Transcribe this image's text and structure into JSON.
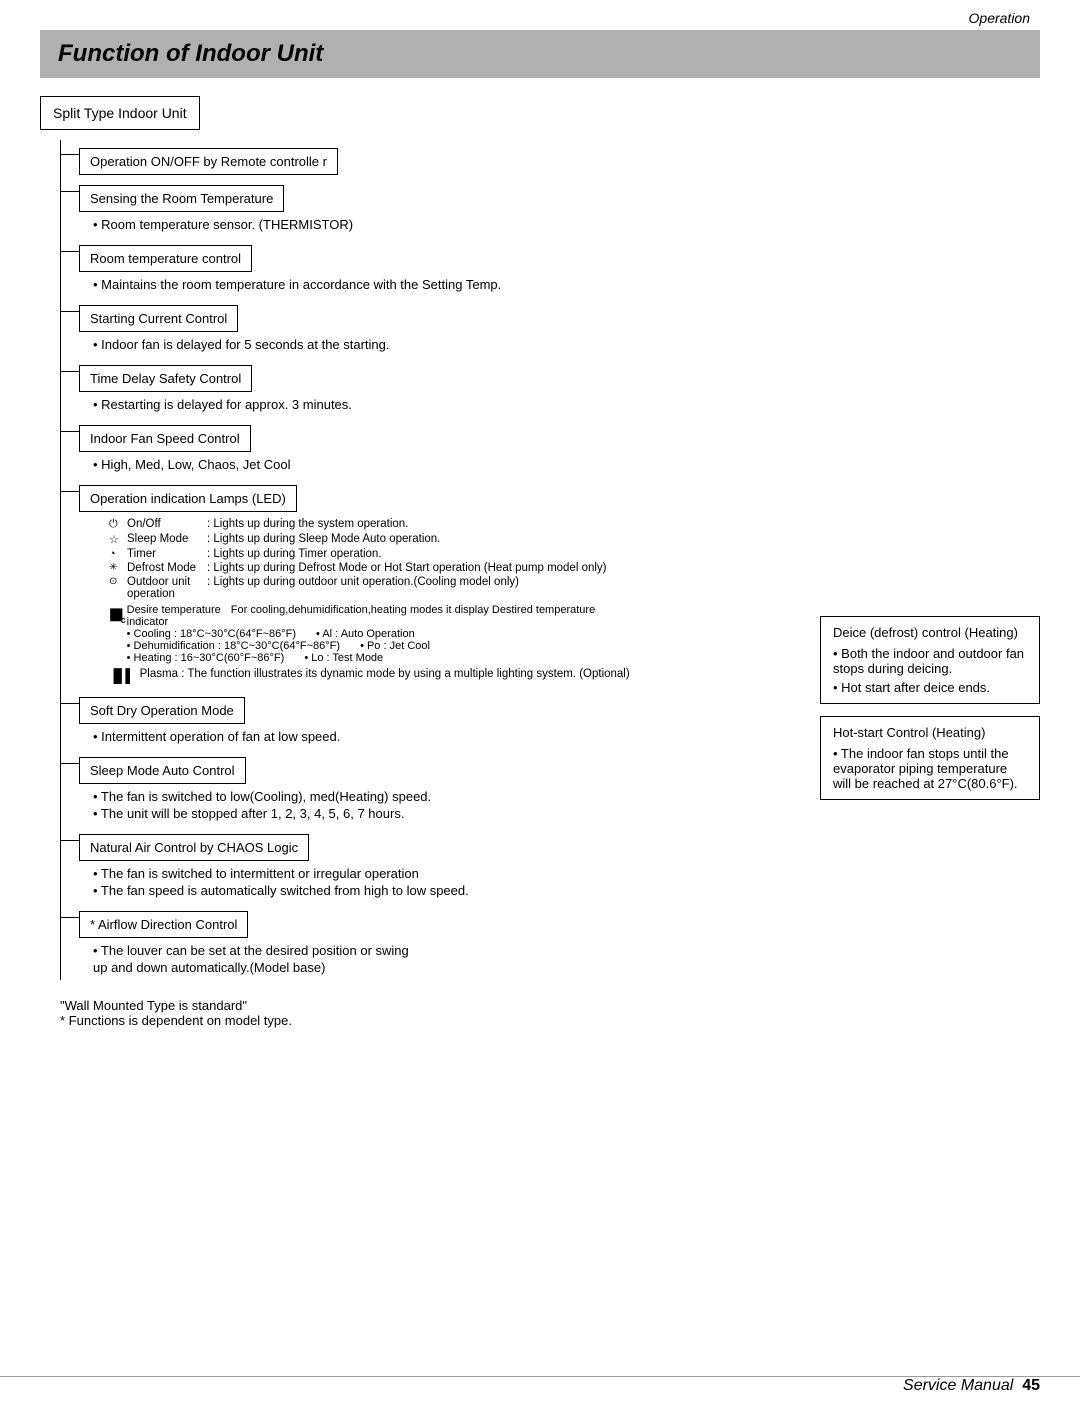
{
  "header": {
    "operation_label": "Operation"
  },
  "title": "Function of Indoor Unit",
  "split_type_label": "Split Type  Indoor Unit",
  "sections": {
    "on_off": "Operation ON/OFF by Remote controlle  r",
    "sensing": "Sensing the Room Temperature",
    "sensing_bullet": "• Room temperature sensor. (THERMISTOR)",
    "room_temp": "Room temperature control",
    "room_temp_bullet": "• Maintains the room temperature in accordance with the Setting Temp.",
    "starting": "Starting Current Control",
    "starting_bullet": "• Indoor fan is delayed for 5 seconds at the starting.",
    "time_delay": "Time Delay Safety Control",
    "time_delay_bullet": "• Restarting is delayed for approx. 3 minutes.",
    "fan_speed": "Indoor Fan Speed Control",
    "fan_speed_bullet": "• High, Med, Low, Chaos, Jet Cool",
    "led": "Operation indication Lamps (LED)",
    "led_items": [
      {
        "icon": "⏻",
        "label": "On/Off",
        "desc": ": Lights up during the system operation."
      },
      {
        "icon": "☆",
        "label": "Sleep Mode",
        "desc": ": Lights up during Sleep Mode Auto operation."
      },
      {
        "icon": "⏱",
        "label": "Timer",
        "desc": ": Lights up during Timer operation."
      },
      {
        "icon": "❄",
        "label": "Defrost Mode",
        "desc": ": Lights up during Defrost Mode or Hot Start operation (Heat pump model only)"
      },
      {
        "icon": "⊙",
        "label": "Outdoor unit operation",
        "desc": ": Lights up during outdoor unit operation.(Cooling model only)"
      }
    ],
    "temp_indicator": {
      "label": "Desire temperature",
      "desc": "For cooling,dehumidification,heating modes it display Destired temperature",
      "c_label": "indicator",
      "sub_rows": [
        {
          "left": "• Cooling          : 18°C~30°C(64°F~86°F)",
          "right": "• Al   : Auto Operation"
        },
        {
          "left": "• Dehumidification : 18°C~30°C(64°F~86°F)",
          "right": "• Po  : Jet Cool"
        },
        {
          "left": "• Heating          : 16~30°C(60°F~86°F)",
          "right": "• Lo   : Test Mode"
        }
      ]
    },
    "plasma": "Plasma",
    "plasma_desc": ": The function illustrates its dynamic mode by using a multiple lighting system. (Optional)",
    "soft_dry": "Soft Dry Operation Mode",
    "soft_dry_bullet": "• Intermittent operation of fan at low speed.",
    "sleep_mode": "Sleep Mode Auto Control",
    "sleep_mode_bullets": [
      "• The fan is switched to low(Cooling), med(Heating) speed.",
      "• The unit will be stopped after 1, 2, 3, 4, 5, 6, 7 hours."
    ],
    "natural_air": "Natural Air Control by CHAOS Logic",
    "natural_air_bullets": [
      "• The fan is switched to intermittent or irregular operation",
      "• The fan speed is automatically switched from high to low speed."
    ],
    "airflow": "* Airflow Direction Control",
    "airflow_bullets": [
      "• The louver can be set at the desired position or swing",
      "  up and down automatically.(Model base)"
    ]
  },
  "right_column": {
    "deice_title": "Deice (defrost) control (Heating)",
    "deice_bullets": [
      "• Both the indoor and outdoor fan stops during deicing.",
      "• Hot start after deice ends."
    ],
    "hotstart_title": "Hot-start Control (Heating)",
    "hotstart_bullets": [
      "• The indoor fan stops until the evaporator piping temperature will be reached at 27°C(80.6°F)."
    ]
  },
  "footer": {
    "note1": "\"Wall Mounted Type is standard\"",
    "note2": "* Functions is dependent on model type.",
    "service_manual": "Service Manual",
    "page_number": "45"
  }
}
